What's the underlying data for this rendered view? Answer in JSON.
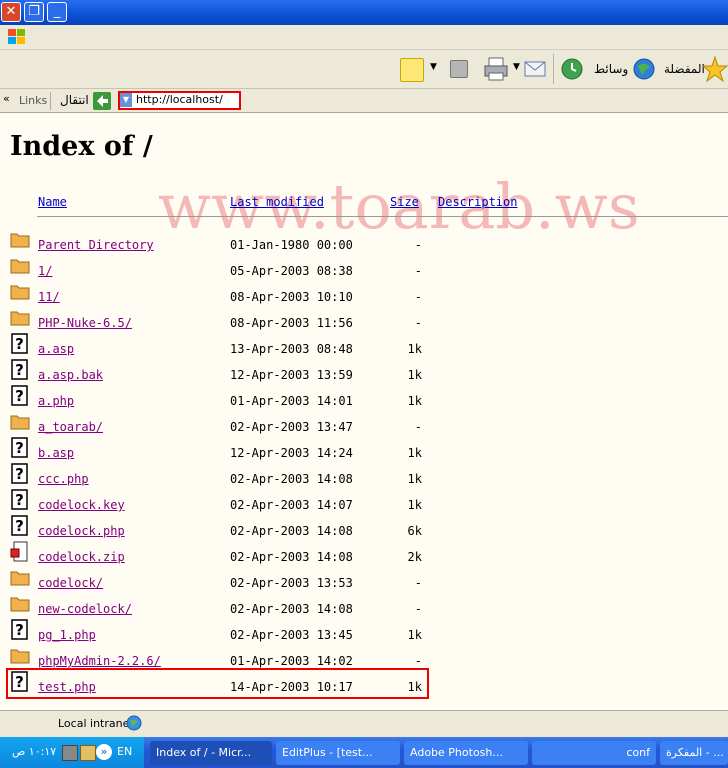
{
  "window": {
    "close_glyph": "✕",
    "restore_glyph": "❐",
    "min_glyph": "_"
  },
  "toolbar": {
    "favorites_label": "المفضلة",
    "media_label": "وسائط"
  },
  "linksbar": {
    "links_label": "Links",
    "go_label": "انتقال",
    "chevron": "«"
  },
  "address": {
    "url": "http://localhost/"
  },
  "page": {
    "title": "Index of /",
    "watermark": "www.toarab.ws",
    "headers": {
      "name": "Name",
      "last_modified": "Last modified",
      "size": "Size",
      "description": "Description"
    },
    "rows": [
      {
        "name": "Parent Directory",
        "modified": "01-Jan-1980 00:00",
        "size": "-",
        "icon": "folder-icon"
      },
      {
        "name": "1/",
        "modified": "05-Apr-2003 08:38",
        "size": "-",
        "icon": "folder-icon"
      },
      {
        "name": "11/",
        "modified": "08-Apr-2003 10:10",
        "size": "-",
        "icon": "folder-icon"
      },
      {
        "name": "PHP-Nuke-6.5/",
        "modified": "08-Apr-2003 11:56",
        "size": "-",
        "icon": "folder-icon"
      },
      {
        "name": "a.asp",
        "modified": "13-Apr-2003 08:48",
        "size": "1k",
        "icon": "unknown-file-icon"
      },
      {
        "name": "a.asp.bak",
        "modified": "12-Apr-2003 13:59",
        "size": "1k",
        "icon": "unknown-file-icon"
      },
      {
        "name": "a.php",
        "modified": "01-Apr-2003 14:01",
        "size": "1k",
        "icon": "unknown-file-icon"
      },
      {
        "name": "a_toarab/",
        "modified": "02-Apr-2003 13:47",
        "size": "-",
        "icon": "folder-icon"
      },
      {
        "name": "b.asp",
        "modified": "12-Apr-2003 14:24",
        "size": "1k",
        "icon": "unknown-file-icon"
      },
      {
        "name": "ccc.php",
        "modified": "02-Apr-2003 14:08",
        "size": "1k",
        "icon": "unknown-file-icon"
      },
      {
        "name": "codelock.key",
        "modified": "02-Apr-2003 14:07",
        "size": "1k",
        "icon": "unknown-file-icon"
      },
      {
        "name": "codelock.php",
        "modified": "02-Apr-2003 14:08",
        "size": "6k",
        "icon": "unknown-file-icon"
      },
      {
        "name": "codelock.zip",
        "modified": "02-Apr-2003 14:08",
        "size": "2k",
        "icon": "zip-file-icon"
      },
      {
        "name": "codelock/",
        "modified": "02-Apr-2003 13:53",
        "size": "-",
        "icon": "folder-icon"
      },
      {
        "name": "new-codelock/",
        "modified": "02-Apr-2003 14:08",
        "size": "-",
        "icon": "folder-icon"
      },
      {
        "name": "pg_1.php",
        "modified": "02-Apr-2003 13:45",
        "size": "1k",
        "icon": "unknown-file-icon"
      },
      {
        "name": "phpMyAdmin-2.2.6/",
        "modified": "01-Apr-2003 14:02",
        "size": "-",
        "icon": "folder-icon"
      },
      {
        "name": "test.php",
        "modified": "14-Apr-2003 10:17",
        "size": "1k",
        "icon": "unknown-file-icon"
      }
    ]
  },
  "statusbar": {
    "zone": "Local intranet"
  },
  "taskbar": {
    "clock": "١٠:١٧ ص",
    "language": "EN",
    "tasks": [
      {
        "label": "Index of / - Micr..."
      },
      {
        "label": "EditPlus - [test..."
      },
      {
        "label": "Adobe Photosh..."
      },
      {
        "label": "conf"
      },
      {
        "label": "المفكرة - ..."
      }
    ]
  },
  "colors": {
    "titlebar": "#0a4fd6",
    "link_visited": "#800080",
    "link": "#0000cc",
    "highlight": "#ee0000",
    "watermark": "#f4b8b6"
  }
}
